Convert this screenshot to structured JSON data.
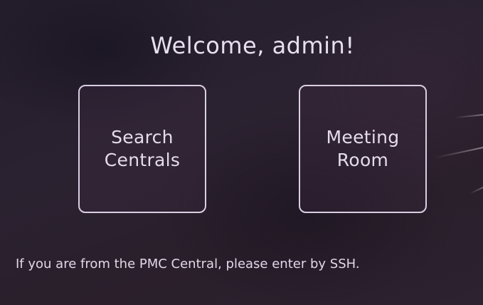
{
  "welcome": {
    "title": "Welcome, admin!"
  },
  "cards": {
    "search": {
      "label": "Search\nCentrals"
    },
    "meeting": {
      "label": "Meeting\nRoom"
    }
  },
  "footer": {
    "text": "If you are from the PMC Central, please enter by SSH."
  },
  "colors": {
    "background": "#2a2230",
    "text": "#e2d9ea",
    "card_border": "#d9cfe2"
  }
}
